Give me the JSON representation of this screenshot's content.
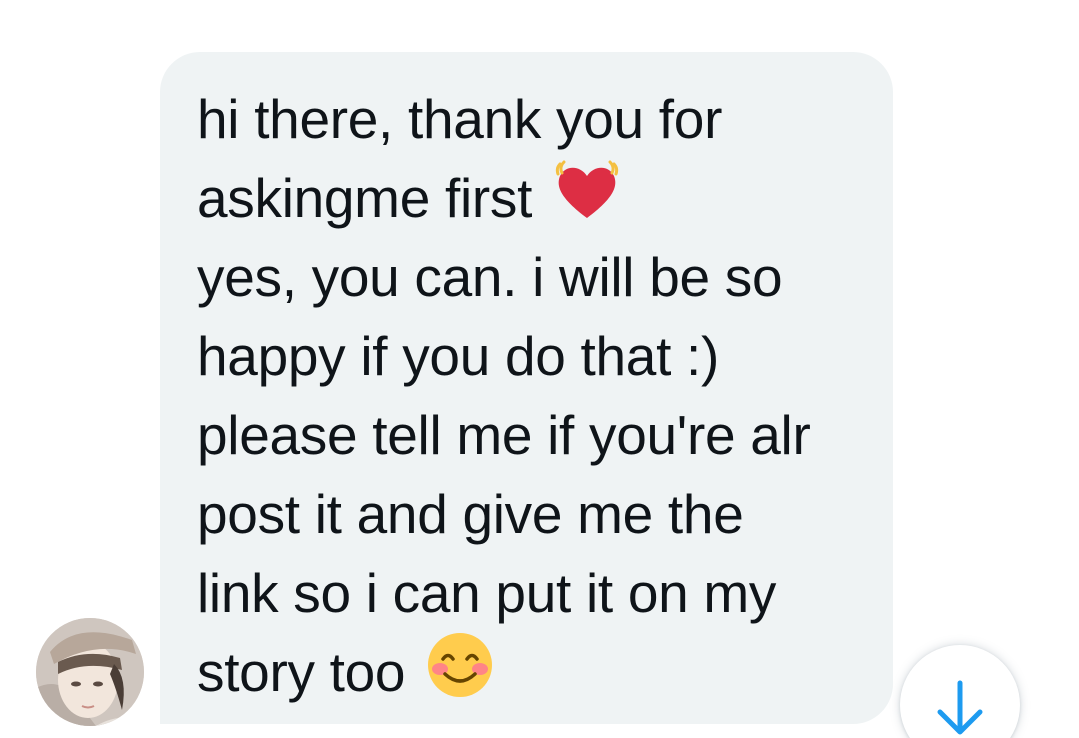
{
  "message": {
    "lines": [
      "hi there, thank you for",
      "askingme first",
      "yes, you can. i will be so",
      "happy if you do that :)",
      "please tell me if you're alr",
      "post it and give me the",
      "link so i can put it on my",
      "story too"
    ],
    "emojis": {
      "line2": "beating-heart-emoji",
      "line8": "smiling-face-with-smiling-eyes-emoji"
    }
  },
  "colors": {
    "bubble": "#eff3f4",
    "text": "#0f1419",
    "accent": "#1d9bf0",
    "heart": "#dd2e44"
  },
  "icons": {
    "scroll_down": "arrow-down-icon",
    "avatar": "sender-avatar"
  }
}
